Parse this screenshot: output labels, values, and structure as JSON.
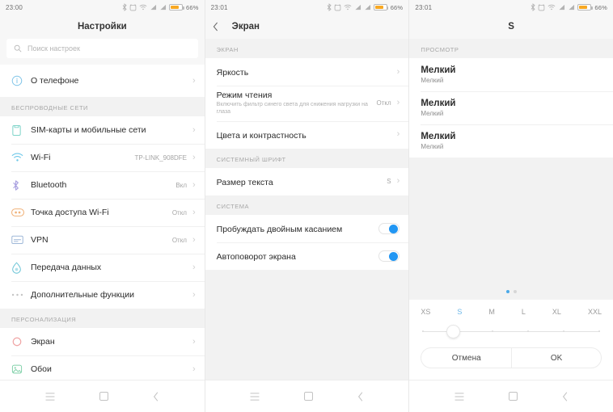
{
  "statusbar": {
    "time_left": "23:00",
    "time_mid": "23:01",
    "time_right": "23:01",
    "battery_percent": "66%",
    "icons": [
      "bluetooth-icon",
      "alarm-icon",
      "wifi-icon",
      "signal-1-icon",
      "signal-2-icon",
      "battery-icon"
    ],
    "battery_color": "#f7a823"
  },
  "panel1": {
    "title": "Настройки",
    "search": {
      "placeholder": "Поиск настроек"
    },
    "about": {
      "label": "О телефоне",
      "icon": "info-circle-icon",
      "color": "#7fc4e8"
    },
    "groups": [
      {
        "label": "БЕСПРОВОДНЫЕ СЕТИ",
        "items": [
          {
            "label": "SIM-карты и мобильные сети",
            "value": "",
            "icon": "sim-card-icon",
            "color": "#7fd4c9"
          },
          {
            "label": "Wi-Fi",
            "value": "TP-LINK_908DFE",
            "icon": "wifi-icon",
            "color": "#6cc7e8"
          },
          {
            "label": "Bluetooth",
            "value": "Вкл",
            "icon": "bluetooth-icon",
            "color": "#a9a0e0"
          },
          {
            "label": "Точка доступа Wi-Fi",
            "value": "Откл",
            "icon": "hotspot-icon",
            "color": "#f0b27a"
          },
          {
            "label": "VPN",
            "value": "Откл",
            "icon": "vpn-icon",
            "color": "#9fb8d8"
          },
          {
            "label": "Передача данных",
            "value": "",
            "icon": "data-usage-icon",
            "color": "#6fc6d8"
          },
          {
            "label": "Дополнительные функции",
            "value": "",
            "icon": "more-dots-icon",
            "color": "#bdbdbd"
          }
        ]
      },
      {
        "label": "ПЕРСОНАЛИЗАЦИЯ",
        "items": [
          {
            "label": "Экран",
            "value": "",
            "icon": "display-circle-icon",
            "color": "#f0a6a6"
          },
          {
            "label": "Обои",
            "value": "",
            "icon": "wallpaper-icon",
            "color": "#7fd0a8"
          }
        ]
      }
    ]
  },
  "panel2": {
    "title": "Экран",
    "back_icon": "chevron-left-icon",
    "groups": [
      {
        "label": "ЭКРАН",
        "items": [
          {
            "label": "Яркость",
            "sub": "",
            "value": ""
          },
          {
            "label": "Режим чтения",
            "sub": "Включить фильтр синего света для снижения нагрузки на глаза",
            "value": "Откл"
          },
          {
            "label": "Цвета и контрастность",
            "sub": "",
            "value": ""
          }
        ]
      },
      {
        "label": "СИСТЕМНЫЙ ШРИФТ",
        "items": [
          {
            "label": "Размер текста",
            "sub": "",
            "value": "S"
          }
        ]
      },
      {
        "label": "СИСТЕМА",
        "toggles": [
          {
            "label": "Пробуждать двойным касанием",
            "on": true
          },
          {
            "label": "Автоповорот экрана",
            "on": true
          }
        ]
      }
    ],
    "toggle_color": "#2196f3"
  },
  "panel3": {
    "title": "S",
    "preview_label": "ПРОСМОТР",
    "preview_rows": [
      {
        "primary": "Мелкий",
        "secondary": "Мелкий"
      },
      {
        "primary": "Мелкий",
        "secondary": "Мелкий"
      },
      {
        "primary": "Мелкий",
        "secondary": "Мелкий"
      }
    ],
    "page_dots": {
      "count": 2,
      "active_index": 0,
      "active_color": "#4aa9e8"
    },
    "size_slider": {
      "ticks": [
        "XS",
        "S",
        "M",
        "L",
        "XL",
        "XXL"
      ],
      "selected": "S",
      "selected_index": 1,
      "selected_color": "#6cb7e8"
    },
    "buttons": {
      "cancel": "Отмена",
      "ok": "OK"
    }
  },
  "navbar": {
    "menu_icon": "menu-icon",
    "home_icon": "home-square-icon",
    "back_icon": "chevron-left-icon"
  }
}
